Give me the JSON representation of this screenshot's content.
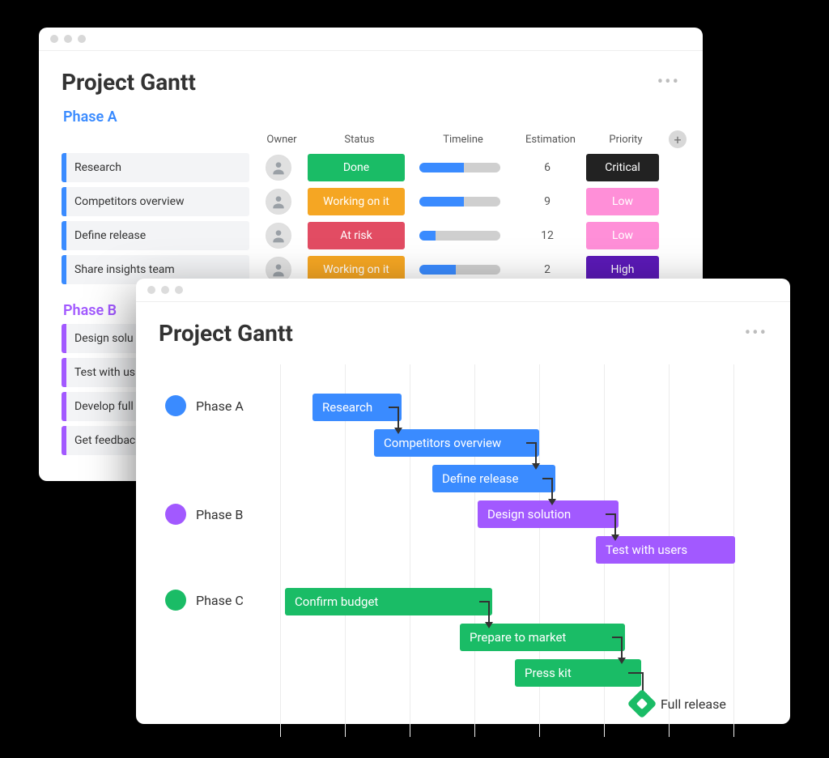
{
  "app_title": "Project Gantt",
  "table": {
    "phase_a_label": "Phase A",
    "phase_b_label": "Phase B",
    "columns": {
      "owner": "Owner",
      "status": "Status",
      "timeline": "Timeline",
      "estimation": "Estimation",
      "priority": "Priority"
    },
    "phase_a_rows": [
      {
        "task": "Research",
        "status": "Done",
        "status_class": "status-done",
        "timeline_pct": 55,
        "estimation": "6",
        "priority": "Critical",
        "priority_class": "prio-critical"
      },
      {
        "task": "Competitors overview",
        "status": "Working on it",
        "status_class": "status-work",
        "timeline_pct": 55,
        "estimation": "9",
        "priority": "Low",
        "priority_class": "prio-low"
      },
      {
        "task": "Define release",
        "status": "At risk",
        "status_class": "status-risk",
        "timeline_pct": 20,
        "estimation": "12",
        "priority": "Low",
        "priority_class": "prio-low"
      },
      {
        "task": "Share insights team",
        "status": "Working on it",
        "status_class": "status-work",
        "timeline_pct": 45,
        "estimation": "2",
        "priority": "High",
        "priority_class": "prio-high"
      }
    ],
    "phase_b_rows": [
      {
        "task": "Design solu"
      },
      {
        "task": "Test with us"
      },
      {
        "task": "Develop full"
      },
      {
        "task": "Get feedbac"
      }
    ]
  },
  "gantt": {
    "lanes": [
      {
        "label": "Phase A",
        "color": "#3a8bff"
      },
      {
        "label": "Phase B",
        "color": "#a259ff"
      },
      {
        "label": "Phase C",
        "color": "#1abc66"
      }
    ],
    "bars": {
      "research": "Research",
      "competitors": "Competitors overview",
      "define": "Define release",
      "design": "Design solution",
      "test": "Test with users",
      "confirm": "Confirm budget",
      "market": "Prepare to market",
      "press": "Press kit"
    },
    "milestone": "Full release"
  },
  "chart_data": {
    "type": "bar",
    "title": "Project Gantt",
    "groups": [
      {
        "name": "Phase A",
        "color": "#3a8bff",
        "tasks": [
          {
            "name": "Research",
            "start": 1,
            "end": 2
          },
          {
            "name": "Competitors overview",
            "start": 2,
            "end": 4
          },
          {
            "name": "Define release",
            "start": 3,
            "end": 4.3
          },
          {
            "name": "Share insights team",
            "start": null,
            "end": null
          }
        ]
      },
      {
        "name": "Phase B",
        "color": "#a259ff",
        "tasks": [
          {
            "name": "Design solution",
            "start": 3.6,
            "end": 5.2
          },
          {
            "name": "Test with users",
            "start": 5.2,
            "end": 6.8
          }
        ]
      },
      {
        "name": "Phase C",
        "color": "#1abc66",
        "tasks": [
          {
            "name": "Confirm budget",
            "start": 0.6,
            "end": 3.3
          },
          {
            "name": "Prepare to market",
            "start": 3.3,
            "end": 5.3
          },
          {
            "name": "Press kit",
            "start": 4.2,
            "end": 5.7
          }
        ],
        "milestones": [
          {
            "name": "Full release",
            "at": 6.2
          }
        ]
      }
    ],
    "xlim": [
      0,
      7
    ],
    "dependencies": [
      [
        "Research",
        "Competitors overview"
      ],
      [
        "Competitors overview",
        "Define release"
      ],
      [
        "Define release",
        "Design solution"
      ],
      [
        "Design solution",
        "Test with users"
      ],
      [
        "Confirm budget",
        "Prepare to market"
      ],
      [
        "Prepare to market",
        "Press kit"
      ],
      [
        "Press kit",
        "Full release"
      ]
    ]
  }
}
